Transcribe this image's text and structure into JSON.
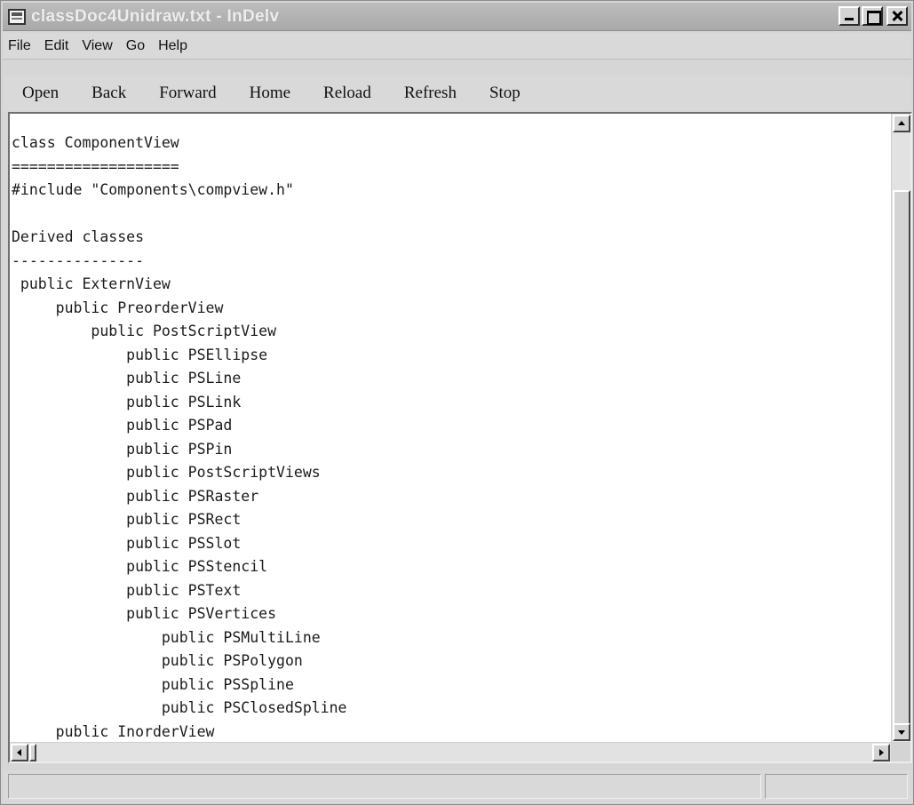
{
  "window": {
    "title": "classDoc4Unidraw.txt - InDelv"
  },
  "menu": {
    "items": [
      "File",
      "Edit",
      "View",
      "Go",
      "Help"
    ]
  },
  "toolbar": {
    "buttons": [
      "Open",
      "Back",
      "Forward",
      "Home",
      "Reload",
      "Refresh",
      "Stop"
    ]
  },
  "document": {
    "lines": [
      "class ComponentView",
      "===================",
      "#include \"Components\\compview.h\"",
      "",
      "Derived classes",
      "---------------",
      " public ExternView",
      "     public PreorderView",
      "         public PostScriptView",
      "             public PSEllipse",
      "             public PSLine",
      "             public PSLink",
      "             public PSPad",
      "             public PSPin",
      "             public PostScriptViews",
      "             public PSRaster",
      "             public PSRect",
      "             public PSSlot",
      "             public PSStencil",
      "             public PSText",
      "             public PSVertices",
      "                 public PSMultiLine",
      "                 public PSPolygon",
      "                 public PSSpline",
      "                 public PSClosedSpline",
      "     public InorderView"
    ]
  },
  "statusbar": {
    "main_text": "",
    "aux_text": ""
  }
}
